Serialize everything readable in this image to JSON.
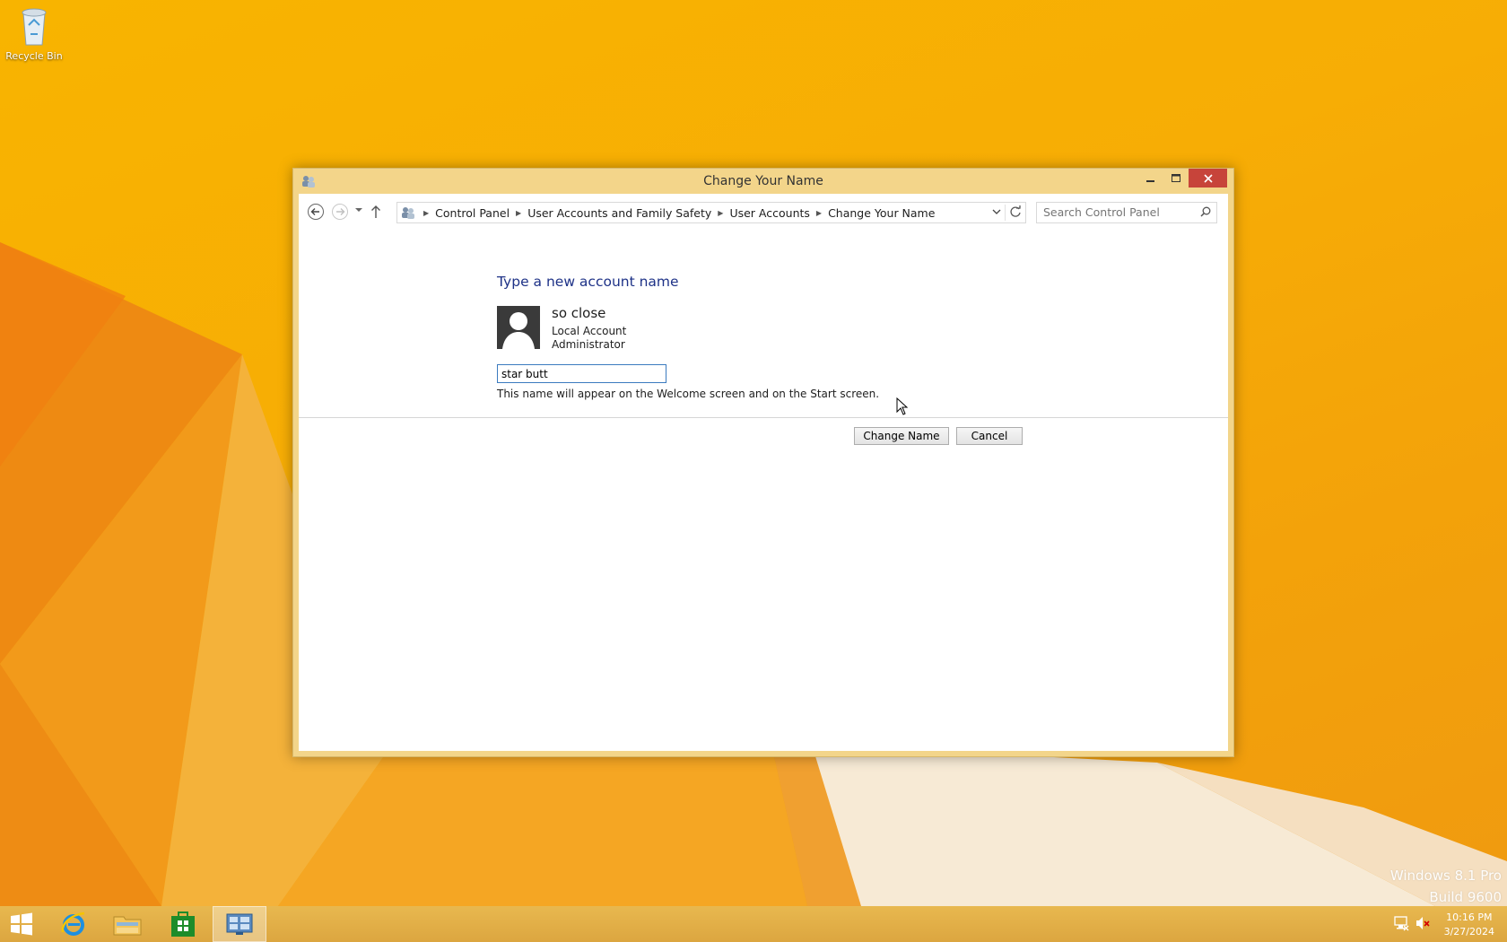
{
  "desktop": {
    "recycle_bin_label": "Recycle Bin",
    "watermark_line1": "Windows 8.1 Pro",
    "watermark_line2": "Build 9600"
  },
  "window": {
    "title": "Change Your Name",
    "breadcrumbs": [
      "Control Panel",
      "User Accounts and Family Safety",
      "User Accounts",
      "Change Your Name"
    ],
    "search_placeholder": "Search Control Panel",
    "heading": "Type a new account name",
    "account": {
      "name": "so close",
      "type": "Local Account",
      "role": "Administrator"
    },
    "new_name_value": "star butt",
    "hint": "This name will appear on the Welcome screen and on the Start screen.",
    "change_button": "Change Name",
    "cancel_button": "Cancel"
  },
  "taskbar": {
    "items": [
      "start-icon",
      "internet-explorer-icon",
      "file-explorer-icon",
      "store-icon",
      "control-panel-icon"
    ],
    "active_item": "control-panel-icon",
    "clock_time": "10:16 PM",
    "clock_date": "3/27/2024"
  },
  "colors": {
    "desktop_bg": "#f7ad05",
    "window_frame": "#f3d58a",
    "close_button": "#c7443a",
    "heading": "#1e3287",
    "taskbar": "#dca640"
  }
}
